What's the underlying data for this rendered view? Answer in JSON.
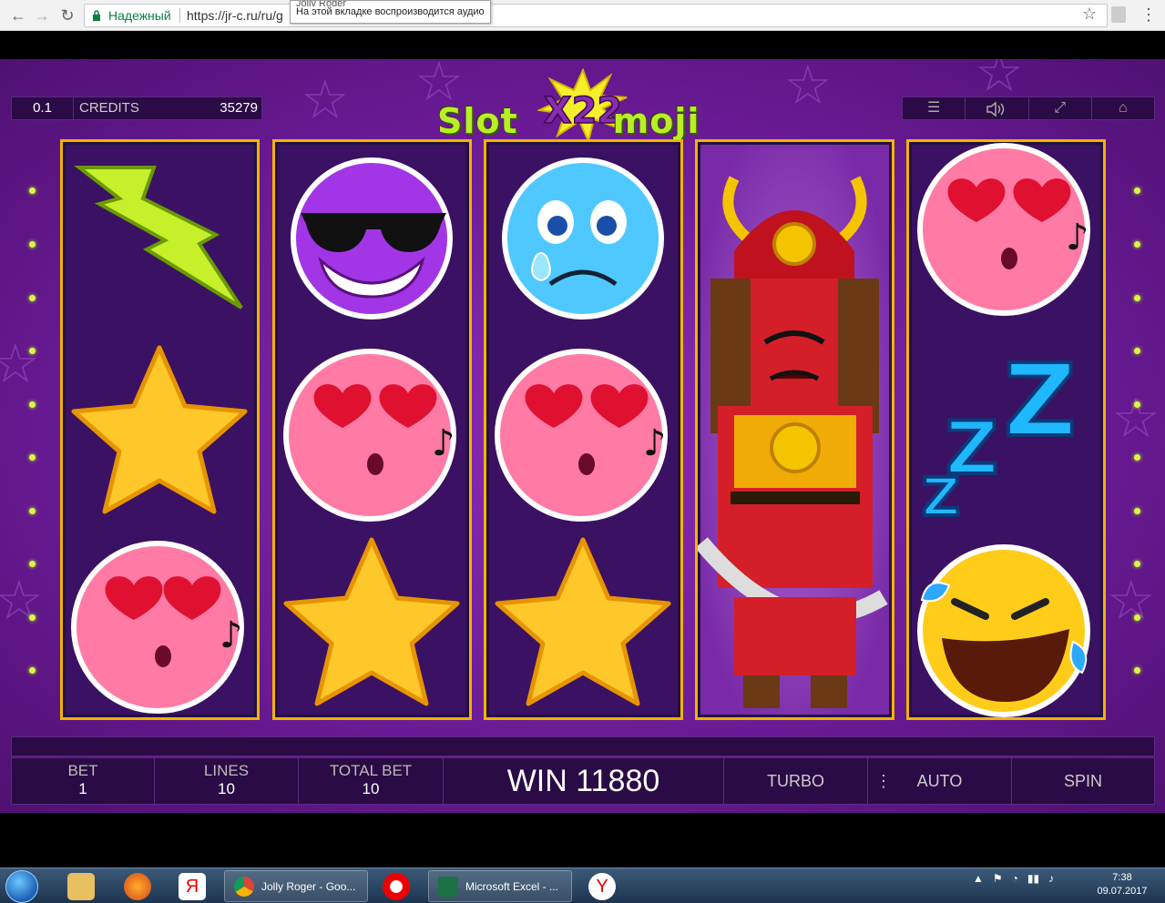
{
  "browser": {
    "secure_label": "Надежный",
    "url": "https://jr-c.ru/ru/g",
    "tooltip_title": "Jolly Roger",
    "tooltip_text": "На этой вкладке воспроизводится аудио"
  },
  "game": {
    "denomination": "0.1",
    "credits_label": "CREDITS",
    "credits_value": "35279",
    "logo_text": "SlotX22moji",
    "logo_number": "22",
    "reels": [
      [
        "lightning",
        "star",
        "love-emoji"
      ],
      [
        "cool-emoji",
        "love-emoji",
        "star"
      ],
      [
        "sad-emoji",
        "love-emoji",
        "star"
      ],
      [
        "samurai"
      ],
      [
        "love-emoji",
        "zzz",
        "laugh-emoji"
      ]
    ]
  },
  "panel": {
    "bet_label": "BET",
    "bet_value": "1",
    "lines_label": "LINES",
    "lines_value": "10",
    "total_bet_label": "TOTAL BET",
    "total_bet_value": "10",
    "win_text": "WIN 11880",
    "turbo_label": "TURBO",
    "auto_label": "AUTO",
    "spin_label": "SPIN"
  },
  "taskbar": {
    "chrome_task": "Jolly Roger - Goo...",
    "excel_task": "Microsoft Excel - ...",
    "time": "7:38",
    "date": "09.07.2017"
  }
}
